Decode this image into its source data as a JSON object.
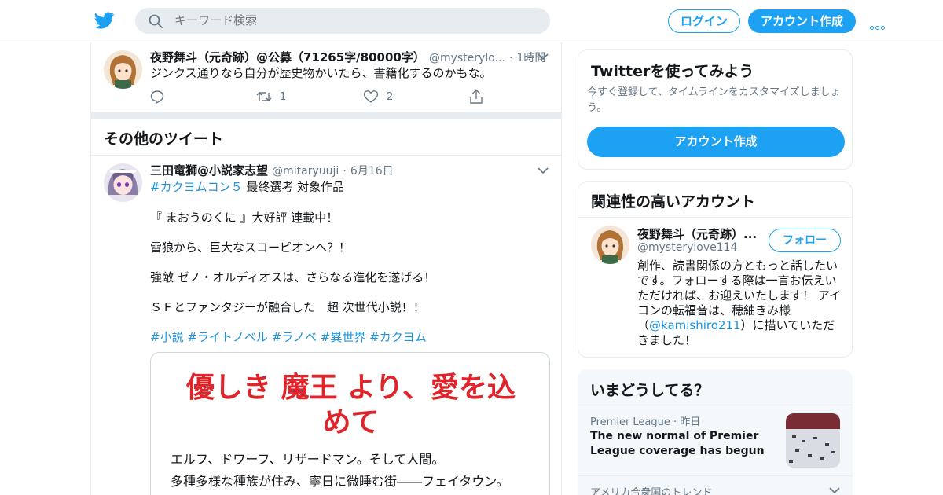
{
  "nav": {
    "search_placeholder": "キーワード検索",
    "login_label": "ログイン",
    "signup_label": "アカウント作成",
    "brand_color": "#1da1f2"
  },
  "tweet1": {
    "name": "夜野舞斗（元奇跡）@公募（71265字/80000字）",
    "handle": "@mysterylo...",
    "dot": "·",
    "time": "1時間",
    "text": "ジンクス通りなら自分が歴史物かいたら、書籍化するのかもな。",
    "retweets": "1",
    "likes": "2"
  },
  "section": {
    "title": "その他のツイート"
  },
  "tweet2": {
    "name": "三田竜獅@小説家志望",
    "handle": "@mitaryuuji",
    "dot": "·",
    "time": "6月16日",
    "hashtag1": "#カクヨムコン５",
    "line1_rest": " 最終選考 対象作品",
    "p1": "『 まおうのくに 』大好評 連載中！",
    "p2": "雷狼から、巨大なスコーピオンへ？！",
    "p3": "強敵 ゼノ・オルディオスは、さらなる進化を遂げる！",
    "p4": "ＳＦとファンタジーが融合した　超 次世代小説！！",
    "tags": [
      "#小説",
      "#ライトノベル",
      "#ラノベ",
      "#異世界",
      "#カクヨム"
    ],
    "card": {
      "title_line1": "優しき 魔王 より、愛を込",
      "title_line2": "めて",
      "text1": "エルフ、ドワーフ、リザードマン。そして人間。",
      "text2": "多種多様な種族が住み、寧日に微睡む街――フェイタウン。"
    }
  },
  "try_card": {
    "title": "Twitterを使ってみよう",
    "subtitle": "今すぐ登録して、タイムラインをカスタマイズしましょう。",
    "button": "アカウント作成"
  },
  "related": {
    "title": "関連性の高いアカウント",
    "name": "夜野舞斗（元奇跡）...",
    "handle": "@mysterylove114",
    "follow": "フォロー",
    "bio_a": "創作、読書関係の方ともっと話したいです。フォローする際は一言お伝えいただければ、お迎えいたします！ アイコンの転福音は、穂紬きみ様（",
    "bio_link": "@kamishiro211",
    "bio_b": "）に描いていただきました！"
  },
  "trends": {
    "title": "いまどうしてる？",
    "item1_meta": "Premier League · 昨日",
    "item1_text": "The new normal of Premier League coverage has begun",
    "item2_meta": "アメリカ合衆国のトレンド"
  }
}
